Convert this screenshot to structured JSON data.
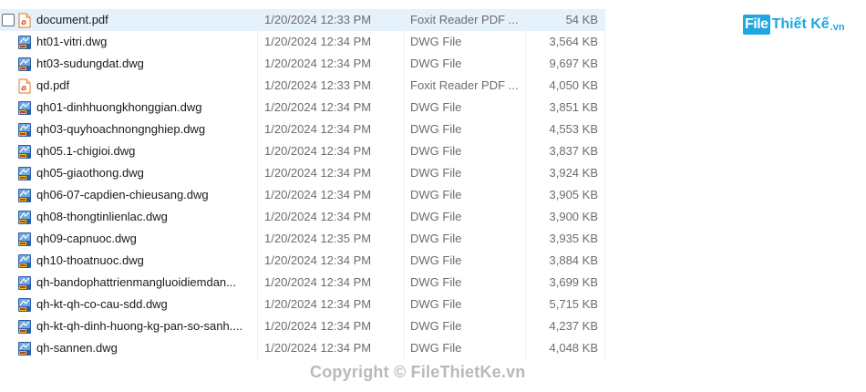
{
  "brand": {
    "logo_box": "File",
    "logo_text": "Thiết Kế",
    "logo_tld": ".vn"
  },
  "watermark": "Copyright © FileThietKe.vn",
  "files": [
    {
      "name": "document.pdf",
      "date": "1/20/2024 12:33 PM",
      "type": "Foxit Reader PDF ...",
      "size": "54 KB",
      "icon": "pdf-icon",
      "selected": true
    },
    {
      "name": "ht01-vitri.dwg",
      "date": "1/20/2024 12:34 PM",
      "type": "DWG File",
      "size": "3,564 KB",
      "icon": "dwg-icon"
    },
    {
      "name": "ht03-sudungdat.dwg",
      "date": "1/20/2024 12:34 PM",
      "type": "DWG File",
      "size": "9,697 KB",
      "icon": "dwg-icon"
    },
    {
      "name": "qd.pdf",
      "date": "1/20/2024 12:33 PM",
      "type": "Foxit Reader PDF ...",
      "size": "4,050 KB",
      "icon": "pdf-icon"
    },
    {
      "name": "qh01-dinhhuongkhonggian.dwg",
      "date": "1/20/2024 12:34 PM",
      "type": "DWG File",
      "size": "3,851 KB",
      "icon": "dwg-icon"
    },
    {
      "name": "qh03-quyhoachnongnghiep.dwg",
      "date": "1/20/2024 12:34 PM",
      "type": "DWG File",
      "size": "4,553 KB",
      "icon": "dwg-icon"
    },
    {
      "name": "qh05.1-chigioi.dwg",
      "date": "1/20/2024 12:34 PM",
      "type": "DWG File",
      "size": "3,837 KB",
      "icon": "dwg-icon"
    },
    {
      "name": "qh05-giaothong.dwg",
      "date": "1/20/2024 12:34 PM",
      "type": "DWG File",
      "size": "3,924 KB",
      "icon": "dwg-icon"
    },
    {
      "name": "qh06-07-capdien-chieusang.dwg",
      "date": "1/20/2024 12:34 PM",
      "type": "DWG File",
      "size": "3,905 KB",
      "icon": "dwg-icon"
    },
    {
      "name": "qh08-thongtinlienlac.dwg",
      "date": "1/20/2024 12:34 PM",
      "type": "DWG File",
      "size": "3,900 KB",
      "icon": "dwg-icon"
    },
    {
      "name": "qh09-capnuoc.dwg",
      "date": "1/20/2024 12:35 PM",
      "type": "DWG File",
      "size": "3,935 KB",
      "icon": "dwg-icon"
    },
    {
      "name": "qh10-thoatnuoc.dwg",
      "date": "1/20/2024 12:34 PM",
      "type": "DWG File",
      "size": "3,884 KB",
      "icon": "dwg-icon"
    },
    {
      "name": "qh-bandophattrienmangluoidiemdan...",
      "date": "1/20/2024 12:34 PM",
      "type": "DWG File",
      "size": "3,699 KB",
      "icon": "dwg-icon"
    },
    {
      "name": "qh-kt-qh-co-cau-sdd.dwg",
      "date": "1/20/2024 12:34 PM",
      "type": "DWG File",
      "size": "5,715 KB",
      "icon": "dwg-icon"
    },
    {
      "name": "qh-kt-qh-dinh-huong-kg-pan-so-sanh....",
      "date": "1/20/2024 12:34 PM",
      "type": "DWG File",
      "size": "4,237 KB",
      "icon": "dwg-icon"
    },
    {
      "name": "qh-sannen.dwg",
      "date": "1/20/2024 12:34 PM",
      "type": "DWG File",
      "size": "4,048 KB",
      "icon": "dwg-icon"
    }
  ]
}
